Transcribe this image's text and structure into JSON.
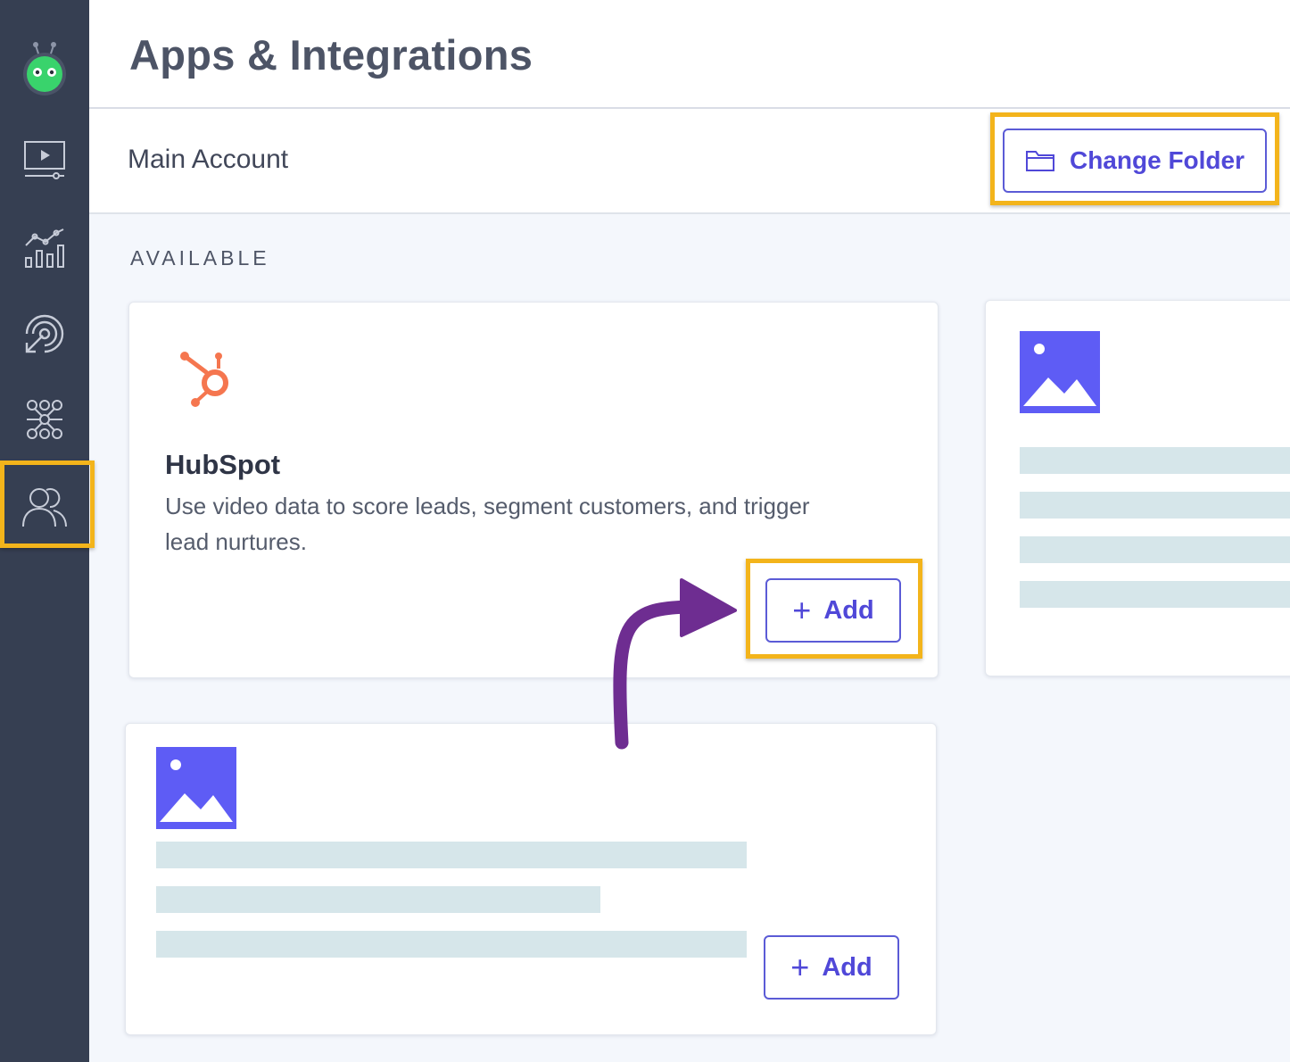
{
  "sidebar": {
    "items": [
      {
        "name": "logo",
        "icon": "robot-logo-icon"
      },
      {
        "name": "videos",
        "icon": "video-library-icon"
      },
      {
        "name": "analytics",
        "icon": "analytics-chart-icon"
      },
      {
        "name": "targeting",
        "icon": "target-icon"
      },
      {
        "name": "network",
        "icon": "network-nodes-icon"
      },
      {
        "name": "contacts",
        "icon": "people-icon",
        "active": true
      }
    ]
  },
  "header": {
    "title": "Apps & Integrations"
  },
  "account": {
    "name": "Main Account",
    "change_folder_label": "Change Folder"
  },
  "section": {
    "label": "AVAILABLE"
  },
  "cards": [
    {
      "name": "HubSpot",
      "icon": "hubspot-icon",
      "description": "Use video data to score leads, segment customers, and trigger lead nurtures.",
      "add_label": "Add"
    },
    {
      "icon": "image-placeholder-icon"
    },
    {
      "icon": "image-placeholder-icon",
      "add_label": "Add"
    }
  ],
  "colors": {
    "sidebar": "#363f52",
    "accent": "#5048d8",
    "highlight": "#f3b41b",
    "arrow": "#6e2d91",
    "hubspot": "#f5764f",
    "placeholder": "#5e5cf5",
    "skeleton": "#d6e6ea"
  }
}
